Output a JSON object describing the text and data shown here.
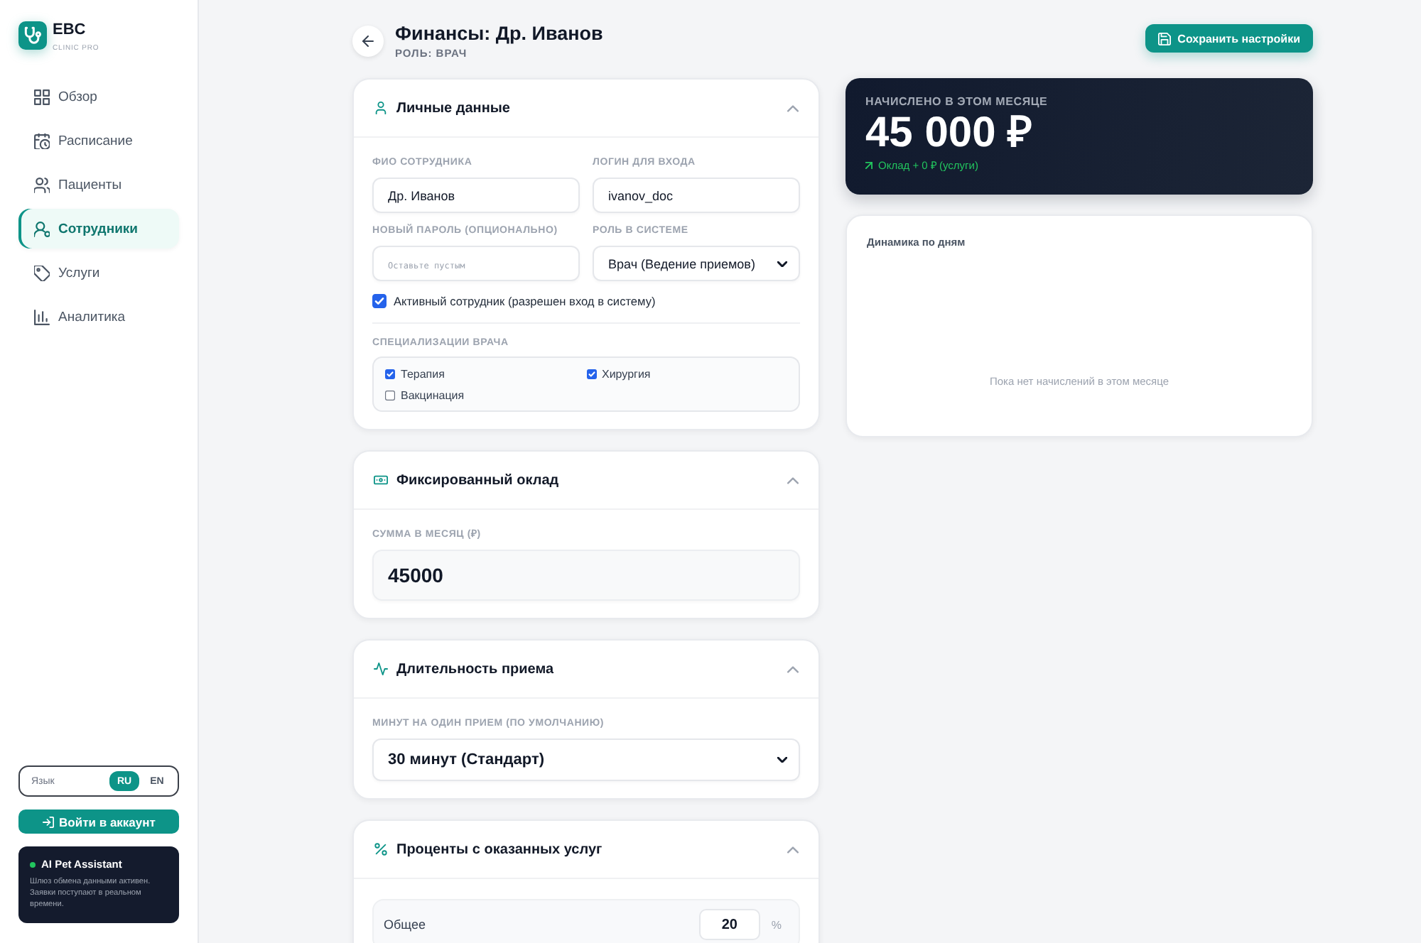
{
  "sidebar": {
    "brand": {
      "title": "EBC",
      "subtitle": "CLINIC PRO"
    },
    "items": [
      {
        "label": "Обзор",
        "selected": false
      },
      {
        "label": "Расписание",
        "selected": false
      },
      {
        "label": "Пациенты",
        "selected": false
      },
      {
        "label": "Сотрудники",
        "selected": true
      },
      {
        "label": "Услуги",
        "selected": false
      },
      {
        "label": "Аналитика",
        "selected": false
      }
    ],
    "language": {
      "label": "Язык",
      "options": [
        {
          "label": "RU",
          "selected": true
        },
        {
          "label": "EN",
          "selected": false
        }
      ]
    },
    "login_button": "Войти в аккаунт",
    "assistant": {
      "title": "AI Pet Assistant",
      "active": true,
      "text": "Шлюз обмена данными активен. Заявки поступают в реальном времени."
    }
  },
  "header": {
    "title": "Финансы: Др. Иванов",
    "subtitle": "РОЛЬ: ВРАЧ",
    "save_button": "Сохранить настройки"
  },
  "sections": [
    {
      "kind": "personal",
      "title": "Личные данные",
      "expanded": true,
      "fields": [
        {
          "kind": "text",
          "label": "ФИО СОТРУДНИКА",
          "value": "Др. Иванов"
        },
        {
          "kind": "text",
          "label": "ЛОГИН ДЛЯ ВХОДА",
          "value": "ivanov_doc"
        },
        {
          "kind": "password",
          "label": "НОВЫЙ ПАРОЛЬ (ОПЦИОНАЛЬНО)",
          "placeholder": "Оставьте пустым"
        },
        {
          "kind": "select",
          "label": "РОЛЬ В СИСТЕМЕ",
          "value": "Врач (Ведение приемов)"
        },
        {
          "kind": "checkbox",
          "label": "Активный сотрудник (разрешен вход в систему)",
          "checked": true
        },
        {
          "kind": "checklist",
          "label": "СПЕЦИАЛИЗАЦИИ ВРАЧА",
          "items": [
            {
              "label": "Терапия",
              "checked": true
            },
            {
              "label": "Хирургия",
              "checked": true
            },
            {
              "label": "Вакцинация",
              "checked": false
            }
          ]
        }
      ]
    },
    {
      "kind": "salary",
      "title": "Фиксированный оклад",
      "expanded": true,
      "fields": [
        {
          "kind": "amount",
          "label": "СУММА В МЕСЯЦ (₽)",
          "value": "45000"
        }
      ]
    },
    {
      "kind": "duration",
      "title": "Длительность приема",
      "expanded": true,
      "fields": [
        {
          "kind": "dropdown",
          "label": "МИНУТ НА ОДИН ПРИЕМ (ПО УМОЛЧАНИЮ)",
          "value": "30 минут (Стандарт)"
        }
      ]
    },
    {
      "kind": "commission",
      "title": "Проценты с оказанных услуг",
      "expanded": true,
      "fields": [
        {
          "kind": "rate",
          "label": "Общее",
          "value": "20",
          "unit": "%"
        }
      ]
    }
  ],
  "summary": {
    "label": "НАЧИСЛЕНО В ЭТОМ МЕСЯЦЕ",
    "amount": "45 000 ₽",
    "breakdown": "Оклад + 0 ₽ (услуги)"
  },
  "daily_chart": {
    "title": "Динамика по дням",
    "empty_message": "Пока нет начислений в этом месяце"
  }
}
